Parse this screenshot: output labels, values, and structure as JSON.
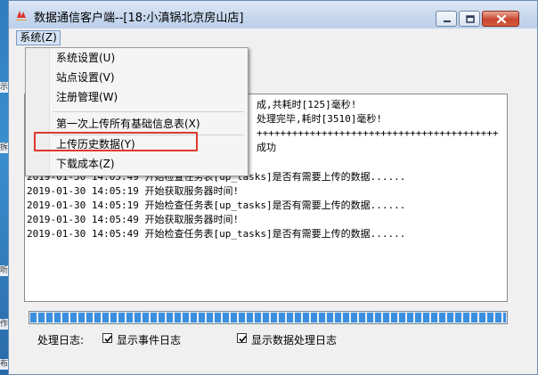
{
  "window": {
    "title": "数据通信客户端--[18:小滇锅北京房山店]"
  },
  "menubar": {
    "system_label": "系统(Z)"
  },
  "dropdown": {
    "items": [
      {
        "label": "系统设置(U)"
      },
      {
        "label": "站点设置(V)"
      },
      {
        "label": "注册管理(W)"
      },
      {
        "label": "第一次上传所有基础信息表(X)"
      },
      {
        "label": "上传历史数据(Y)"
      },
      {
        "label": "下载成本(Z)"
      }
    ]
  },
  "log": {
    "lines": [
      "成,共耗时[125]毫秒!",
      "处理完毕,耗时[3510]毫秒!",
      "+++++++++++++++++++++++++++++++++++++++++",
      "成功",
      "2019-01-30 14:05:49 开始检查任务表[up_tasks]是否有需要上传的数据......",
      "2019-01-30 14:05:19 开始获取服务器时间!",
      "2019-01-30 14:05:19 开始检查任务表[up_tasks]是否有需要上传的数据......",
      "2019-01-30 14:05:49 开始获取服务器时间!",
      "2019-01-30 14:05:49 开始检查任务表[up_tasks]是否有需要上传的数据......"
    ]
  },
  "footer": {
    "log_label": "处理日志:",
    "show_events_label": "显示事件日志",
    "show_events_checked": true,
    "show_data_label": "显示数据处理日志",
    "show_data_checked": true
  },
  "progress": {
    "fraction": 1.0
  },
  "desktop": {
    "fragments": [
      "示",
      "拆",
      "听",
      "作",
      "布"
    ]
  },
  "colors": {
    "highlight": "#e0392b",
    "progress": "#3a8fe0"
  }
}
